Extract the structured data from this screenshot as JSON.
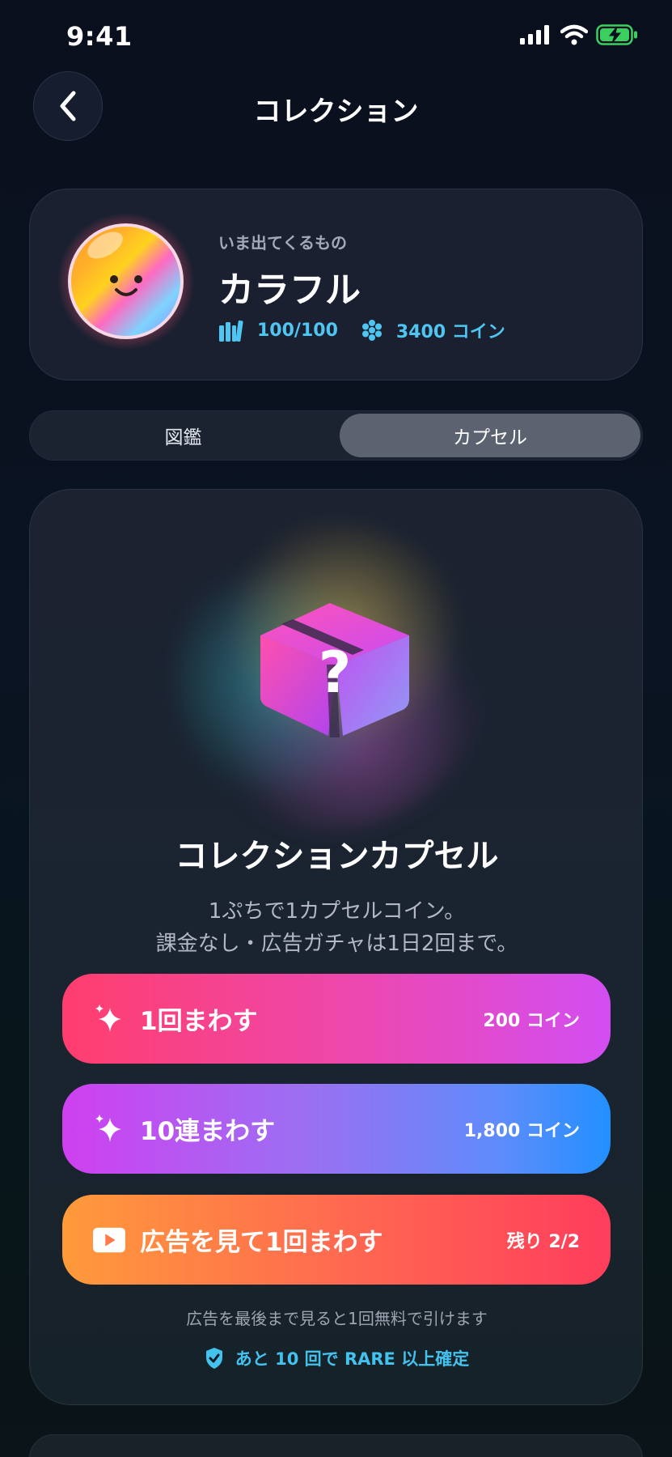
{
  "status_bar": {
    "time": "9:41"
  },
  "nav": {
    "title": "コレクション",
    "back_icon": "chevron-left-icon"
  },
  "current": {
    "label": "いま出てくるもの",
    "name": "カラフル",
    "collection_count": "100/100",
    "coins": "3400 コイン"
  },
  "tabs": [
    {
      "label": "図鑑",
      "selected": false
    },
    {
      "label": "カプセル",
      "selected": true
    }
  ],
  "capsule": {
    "title": "コレクションカプセル",
    "desc_line1": "1ぷちで1カプセルコイン。",
    "desc_line2": "課金なし・広告ガチャは1日2回まで。",
    "buttons": [
      {
        "label": "1回まわす",
        "price": "200 コイン",
        "icon": "sparkles-icon"
      },
      {
        "label": "10連まわす",
        "price": "1,800 コイン",
        "icon": "sparkles-icon"
      },
      {
        "label": "広告を見て1回まわす",
        "price": "残り 2/2",
        "icon": "play-icon"
      }
    ],
    "ad_note": "広告を最後まで見ると1回無料で引けます",
    "rare_note": "あと 10 回で RARE 以上確定"
  },
  "colors": {
    "accent_blue": "#4fc6f2",
    "background": "#0a0f1d"
  }
}
